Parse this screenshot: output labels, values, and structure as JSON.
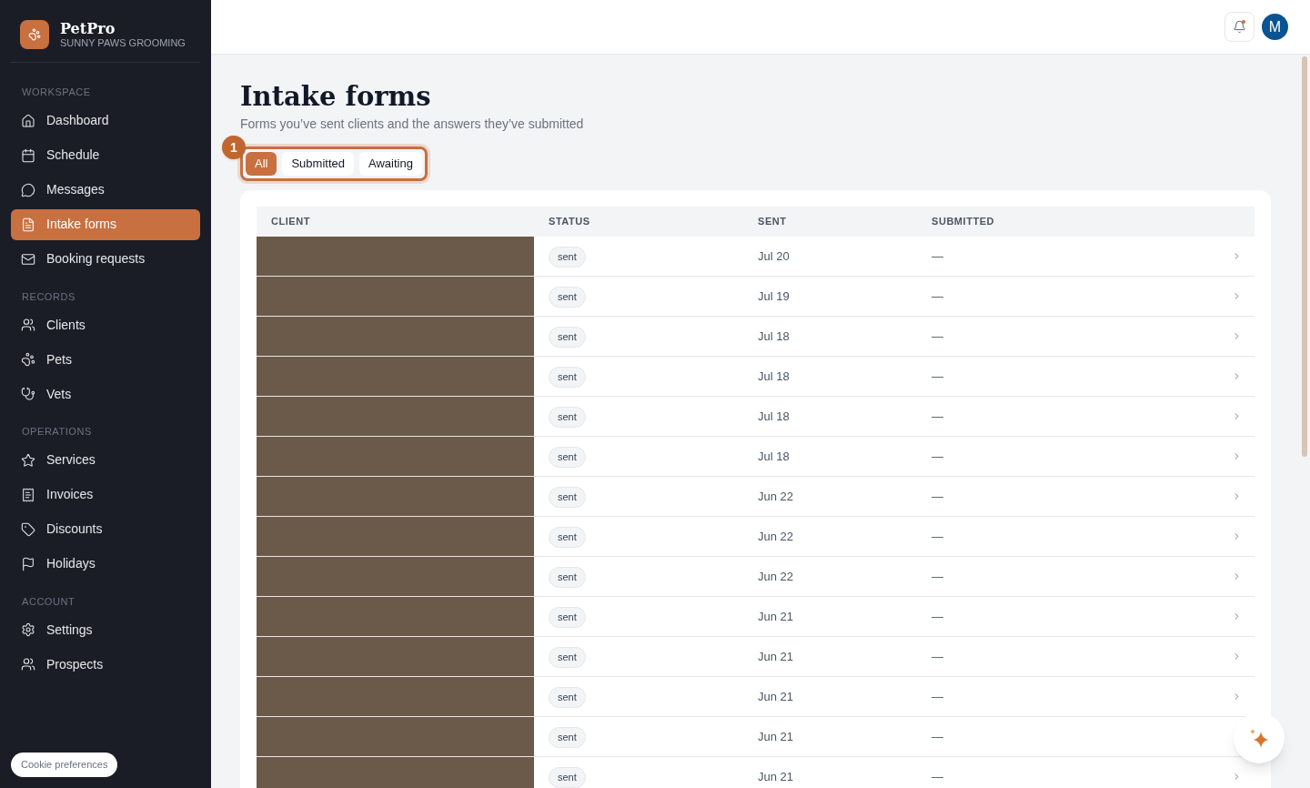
{
  "brand": {
    "name": "PetPro",
    "subtitle": "SUNNY PAWS GROOMING"
  },
  "sidebar": {
    "sections": [
      {
        "title": "WORKSPACE",
        "items": [
          {
            "label": "Dashboard",
            "selected": false
          },
          {
            "label": "Schedule",
            "selected": false
          },
          {
            "label": "Messages",
            "selected": false
          },
          {
            "label": "Intake forms",
            "selected": true
          },
          {
            "label": "Booking requests",
            "selected": false
          }
        ]
      },
      {
        "title": "RECORDS",
        "items": [
          {
            "label": "Clients",
            "selected": false
          },
          {
            "label": "Pets",
            "selected": false
          },
          {
            "label": "Vets",
            "selected": false
          }
        ]
      },
      {
        "title": "OPERATIONS",
        "items": [
          {
            "label": "Services",
            "selected": false
          },
          {
            "label": "Invoices",
            "selected": false
          },
          {
            "label": "Discounts",
            "selected": false
          },
          {
            "label": "Holidays",
            "selected": false
          }
        ]
      },
      {
        "title": "ACCOUNT",
        "items": [
          {
            "label": "Settings",
            "selected": false
          },
          {
            "label": "Prospects",
            "selected": false
          }
        ]
      }
    ],
    "cookie_button": "Cookie preferences"
  },
  "topbar": {
    "avatar": "M",
    "notification_dot": true
  },
  "page": {
    "title": "Intake forms",
    "subtitle": "Forms you’ve sent clients and the answers they’ve submitted",
    "step_badge": "1",
    "filters": [
      {
        "label": "All",
        "selected": true
      },
      {
        "label": "Submitted",
        "selected": false
      },
      {
        "label": "Awaiting",
        "selected": false
      }
    ]
  },
  "table": {
    "columns": [
      "CLIENT",
      "STATUS",
      "SENT",
      "SUBMITTED"
    ],
    "rows": [
      {
        "status": "sent",
        "sent": "Jul 20",
        "submitted": "—"
      },
      {
        "status": "sent",
        "sent": "Jul 19",
        "submitted": "—"
      },
      {
        "status": "sent",
        "sent": "Jul 18",
        "submitted": "—"
      },
      {
        "status": "sent",
        "sent": "Jul 18",
        "submitted": "—"
      },
      {
        "status": "sent",
        "sent": "Jul 18",
        "submitted": "—"
      },
      {
        "status": "sent",
        "sent": "Jul 18",
        "submitted": "—"
      },
      {
        "status": "sent",
        "sent": "Jun 22",
        "submitted": "—"
      },
      {
        "status": "sent",
        "sent": "Jun 22",
        "submitted": "—"
      },
      {
        "status": "sent",
        "sent": "Jun 22",
        "submitted": "—"
      },
      {
        "status": "sent",
        "sent": "Jun 21",
        "submitted": "—"
      },
      {
        "status": "sent",
        "sent": "Jun 21",
        "submitted": "—"
      },
      {
        "status": "sent",
        "sent": "Jun 21",
        "submitted": "—"
      },
      {
        "status": "sent",
        "sent": "Jun 21",
        "submitted": "—"
      },
      {
        "status": "sent",
        "sent": "Jun 21",
        "submitted": "—"
      }
    ]
  }
}
